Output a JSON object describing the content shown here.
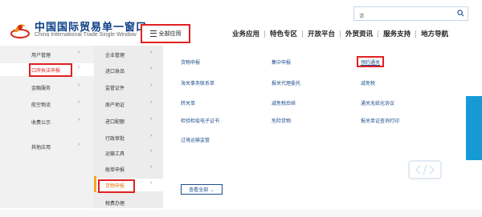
{
  "header": {
    "title": "中国国际贸易单一窗口",
    "subtitle": "China International Trade Single Window",
    "all_apps_label": "全部应用",
    "search_placeholder": "请",
    "nav": [
      "业务应用",
      "特色专区",
      "开放平台",
      "外贸资讯",
      "服务支持",
      "地方导航"
    ]
  },
  "menu1": {
    "items": [
      {
        "label": "用户管理",
        "active": false
      },
      {
        "label": "口岸执法申报",
        "active": true
      },
      {
        "label": "金融服务",
        "active": false
      },
      {
        "label": "航空物流",
        "active": false
      },
      {
        "label": "收费公示",
        "active": false
      },
      {
        "label": "其他应用",
        "active": false
      }
    ]
  },
  "menu2": {
    "items": [
      {
        "label": "企业管理",
        "active": false
      },
      {
        "label": "进口食品",
        "active": false
      },
      {
        "label": "监管证件",
        "active": false
      },
      {
        "label": "原产地证",
        "active": false
      },
      {
        "label": "进口配额",
        "active": false
      },
      {
        "label": "行政审批",
        "active": false
      },
      {
        "label": "运输工具",
        "active": false
      },
      {
        "label": "舱单申报",
        "active": false
      },
      {
        "label": "货物申报",
        "active": true
      },
      {
        "label": "税费办理",
        "active": false
      }
    ]
  },
  "panel": {
    "rows": [
      [
        "货物申报",
        "集中申报",
        "预约通关"
      ],
      [
        "海关事务联系单",
        "报关代理委托",
        "减免税"
      ],
      [
        "转关单",
        "减免税后续",
        "通关无纸化协议"
      ],
      [
        "检验检疫电子证书",
        "危险货物",
        "报关单证查询打印"
      ],
      [
        "过境运输监管",
        "",
        ""
      ]
    ],
    "view_all_label": "查看全部 →"
  },
  "colors": {
    "brand": "#0a3e86",
    "highlight": "#e02020",
    "active_orange": "#e8780c",
    "band": "#159ad6"
  },
  "icons": [
    "logo-icon",
    "menu-icon",
    "search-icon",
    "chevron-right-icon",
    "code-icon"
  ]
}
